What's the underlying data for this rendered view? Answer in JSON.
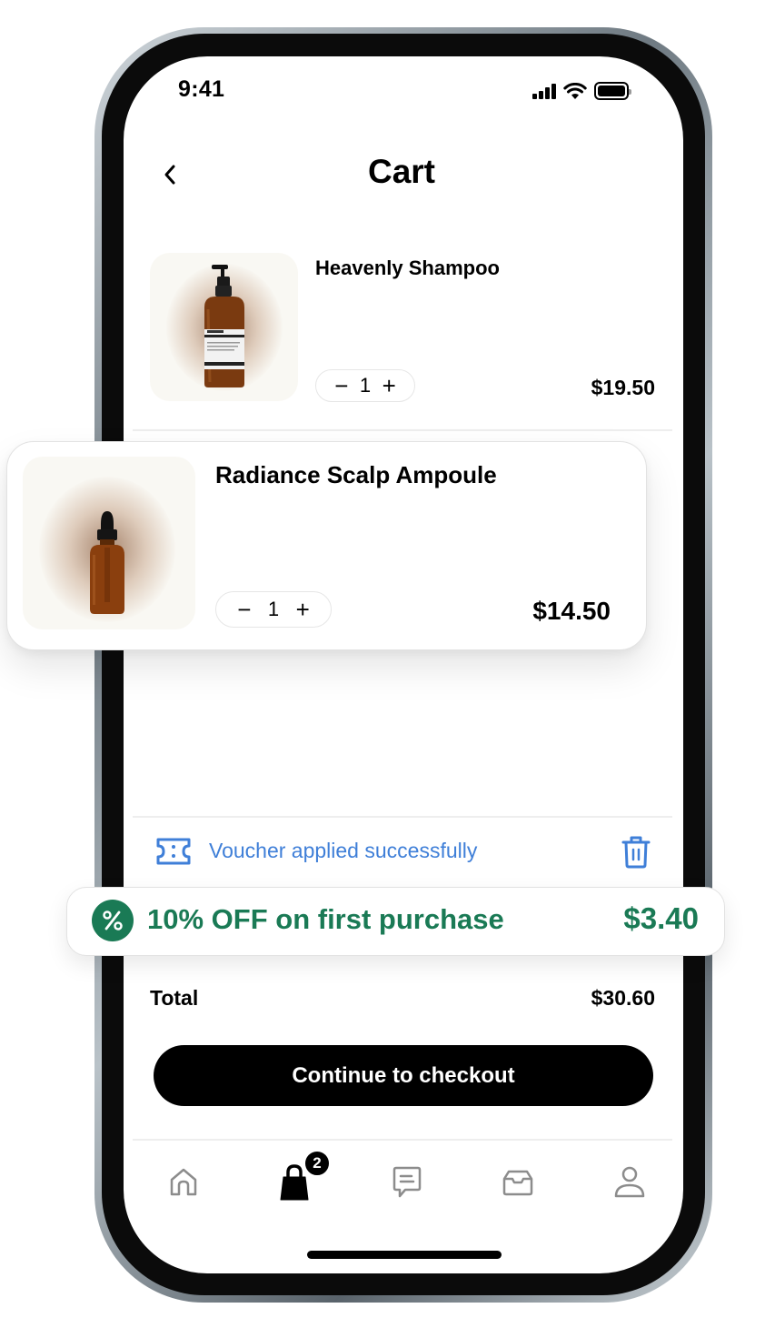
{
  "status_bar": {
    "time": "9:41"
  },
  "header": {
    "title": "Cart",
    "back_icon": "chevron-left-icon"
  },
  "cart_items": [
    {
      "name": "Heavenly Shampoo",
      "quantity": "1",
      "price": "$19.50",
      "image": "amber-pump-bottle"
    },
    {
      "name": "Radiance Scalp Ampoule",
      "quantity": "1",
      "price": "$14.50",
      "image": "amber-dropper-bottle"
    }
  ],
  "quantity_controls": {
    "decrement": "−",
    "increment": "+"
  },
  "voucher": {
    "message": "Voucher applied successfully",
    "icon": "ticket-icon",
    "remove_icon": "trash-icon",
    "color": "#3f7fd8"
  },
  "discount": {
    "label": "10% OFF on first purchase",
    "amount": "$3.40",
    "icon": "percent-icon",
    "color": "#1a7a55"
  },
  "summary": {
    "total_label": "Total",
    "total_value": "$30.60"
  },
  "checkout_button": {
    "label": "Continue to checkout"
  },
  "tab_bar": {
    "items": [
      {
        "name": "home",
        "icon": "home-icon",
        "active": false
      },
      {
        "name": "cart",
        "icon": "shopping-bag-icon",
        "active": true,
        "badge": "2"
      },
      {
        "name": "messages",
        "icon": "chat-icon",
        "active": false
      },
      {
        "name": "orders",
        "icon": "inbox-icon",
        "active": false
      },
      {
        "name": "profile",
        "icon": "user-icon",
        "active": false
      }
    ]
  }
}
